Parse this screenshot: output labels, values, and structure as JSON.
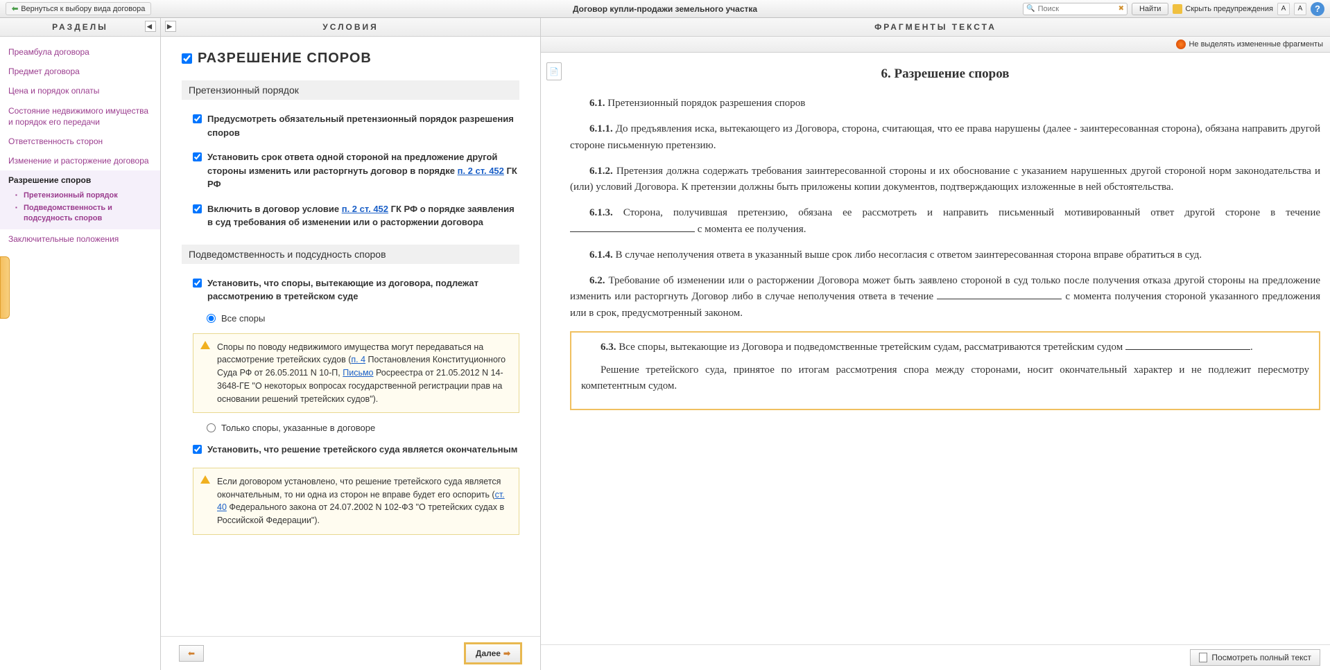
{
  "toolbar": {
    "back_label": "Вернуться к выбору вида договора",
    "doc_title": "Договор купли-продажи земельного участка",
    "search_placeholder": "Поиск",
    "find_label": "Найти",
    "hide_warnings_label": "Скрыть предупреждения",
    "font_small": "A",
    "font_large": "A",
    "help": "?"
  },
  "sidebar": {
    "header": "РАЗДЕЛЫ",
    "items": [
      "Преамбула договора",
      "Предмет договора",
      "Цена и порядок оплаты",
      "Состояние недвижимого имущества и порядок его передачи",
      "Ответственность сторон",
      "Изменение и расторжение договора"
    ],
    "active_item": "Разрешение споров",
    "sub_items": [
      "Претензионный порядок",
      "Подведомственность и подсудность споров"
    ],
    "last_item": "Заключительные положения"
  },
  "conditions": {
    "header": "УСЛОВИЯ",
    "title": "РАЗРЕШЕНИЕ СПОРОВ",
    "sub1": "Претензионный порядок",
    "c1": "Предусмотреть обязательный претензионный порядок разрешения споров",
    "c2_a": "Установить срок ответа одной стороной на предложение другой стороны изменить или расторгнуть договор в порядке ",
    "c2_link": "п. 2 ст. 452",
    "c2_b": " ГК РФ",
    "c3_a": "Включить в договор условие ",
    "c3_link": "п. 2 ст. 452",
    "c3_b": " ГК РФ о порядке заявления в суд требования об изменении или о расторжении договора",
    "sub2": "Подведомственность и подсудность споров",
    "c4": "Установить, что споры, вытекающие из договора, подлежат рассмотрению в третейском суде",
    "r1": "Все споры",
    "r2": "Только споры, указанные в договоре",
    "w1_a": "Споры по поводу недвижимого имущества могут передаваться на рассмотрение третейских судов (",
    "w1_link1": "п. 4",
    "w1_b": " Постановления Конституционного Суда РФ от 26.05.2011 N 10-П, ",
    "w1_link2": "Письмо",
    "w1_c": " Росреестра от 21.05.2012 N 14-3648-ГЕ \"О некоторых вопросах государственной регистрации прав на основании решений третейских судов\").",
    "c5": "Установить, что решение третейского суда является окончательным",
    "w2_a": "Если договором установлено, что решение третейского суда является окончательным, то ни одна из сторон не вправе будет его оспорить (",
    "w2_link": "ст. 40",
    "w2_b": " Федерального закона от 24.07.2002 N 102-ФЗ \"О третейских судах в Российской Федерации\").",
    "next_label": "Далее"
  },
  "fragments": {
    "header": "ФРАГМЕНТЫ ТЕКСТА",
    "toggle_label": "Не выделять измененные фрагменты",
    "title": "6. Разрешение споров",
    "p61": "Претензионный порядок разрешения споров",
    "p611": "До предъявления иска, вытекающего из Договора, сторона, считающая, что ее права нарушены (далее - заинтересованная сторона), обязана направить другой стороне письменную претензию.",
    "p612": "Претензия должна содержать требования заинтересованной стороны и их обоснование с указанием нарушенных другой стороной норм законодательства и (или) условий Договора. К претензии должны быть приложены копии документов, подтверждающих изложенные в ней обстоятельства.",
    "p613_a": "Сторона, получившая претензию, обязана ее рассмотреть и направить письменный мотивированный ответ другой стороне в течение ",
    "p613_b": " с момента ее получения.",
    "p614": "В случае неполучения ответа в указанный выше срок либо несогласия с ответом заинтересованная сторона вправе обратиться в суд.",
    "p62_a": "Требование об изменении или о расторжении Договора может быть заявлено стороной в суд только после получения отказа другой стороны на предложение изменить или расторгнуть Договор либо в случае неполучения ответа в течение ",
    "p62_b": " с момента получения стороной указанного предложения или в срок, предусмотренный законом.",
    "p63_a": "Все споры, вытекающие из Договора и подведомственные третейским судам, рассматриваются третейским судом ",
    "p63_b": ".",
    "p63c": "Решение третейского суда, принятое по итогам рассмотрения спора между сторонами, носит окончательный характер и не подлежит пересмотру компетентным судом.",
    "full_text_label": "Посмотреть полный текст"
  }
}
